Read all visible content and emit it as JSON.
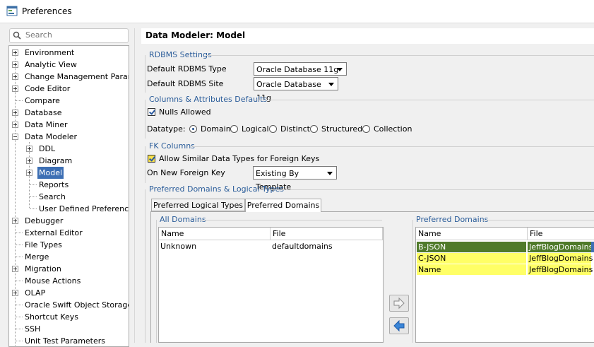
{
  "window": {
    "title": "Preferences"
  },
  "search": {
    "placeholder": "Search"
  },
  "tree": [
    {
      "label": "Environment"
    },
    {
      "label": "Analytic View"
    },
    {
      "label": "Change Management Paramet"
    },
    {
      "label": "Code Editor"
    },
    {
      "label": "Compare"
    },
    {
      "label": "Database"
    },
    {
      "label": "Data Miner"
    },
    {
      "label": "Data Modeler"
    },
    {
      "label": "DDL"
    },
    {
      "label": "Diagram"
    },
    {
      "label": "Model"
    },
    {
      "label": "Reports"
    },
    {
      "label": "Search"
    },
    {
      "label": "User Defined Preferences"
    },
    {
      "label": "Debugger"
    },
    {
      "label": "External Editor"
    },
    {
      "label": "File Types"
    },
    {
      "label": "Merge"
    },
    {
      "label": "Migration"
    },
    {
      "label": "Mouse Actions"
    },
    {
      "label": "OLAP"
    },
    {
      "label": "Oracle Swift Object Storage"
    },
    {
      "label": "Shortcut Keys"
    },
    {
      "label": "SSH"
    },
    {
      "label": "Unit Test Parameters"
    }
  ],
  "page": {
    "title": "Data Modeler: Model"
  },
  "rdbms": {
    "section": "RDBMS Settings",
    "type_label": "Default RDBMS Type",
    "type_value": "Oracle Database 11g",
    "site_label": "Default RDBMS Site",
    "site_value": "Oracle Database 11g"
  },
  "columns": {
    "section": "Columns & Attributes Defaults",
    "nulls_label": "Nulls Allowed",
    "datatype_label": "Datatype:",
    "options": [
      "Domain",
      "Logical",
      "Distinct",
      "Structured",
      "Collection"
    ],
    "selected": "Domain"
  },
  "fk": {
    "section": "FK Columns",
    "allow_label": "Allow Similar Data Types for Foreign Keys",
    "onnew_label": "On New Foreign Key",
    "onnew_value": "Existing By Template"
  },
  "domains": {
    "section": "Preferred Domains & Logical Types",
    "tabs": [
      "Preferred Logical Types",
      "Preferred Domains"
    ],
    "all": {
      "title": "All Domains",
      "headers": [
        "Name",
        "File"
      ],
      "rows": [
        [
          "Unknown",
          "defaultdomains"
        ]
      ]
    },
    "preferred": {
      "title": "Preferred Domains",
      "headers": [
        "Name",
        "File"
      ],
      "rows": [
        [
          "B-JSON",
          "JeffBlogDomains"
        ],
        [
          "C-JSON",
          "JeffBlogDomains"
        ],
        [
          "Name",
          "JeffBlogDomains"
        ]
      ]
    }
  },
  "colors": {
    "highlight": "#ffff66",
    "selected_row": "#4f7a2a",
    "section_title": "#2b5d9a",
    "tree_selected": "#3d6fb4"
  },
  "icons": {
    "add": "arrow-right-icon",
    "remove": "arrow-left-icon"
  }
}
